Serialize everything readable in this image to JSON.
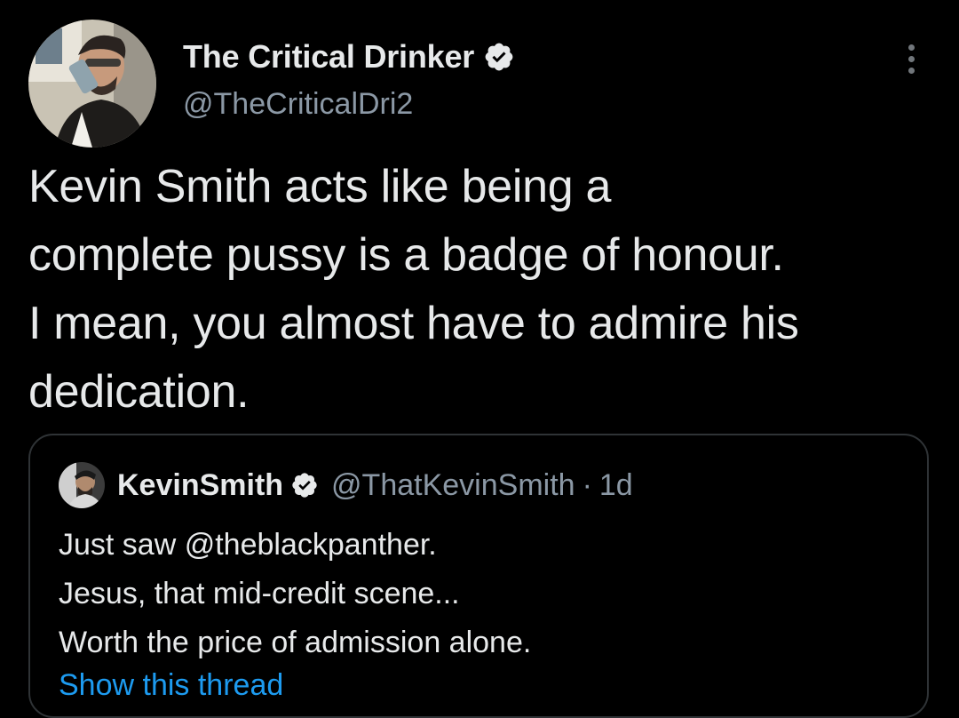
{
  "theme": {
    "background": "#000000",
    "text": "#e7e9ea",
    "secondary_text": "#8b98a5",
    "link": "#1d9bf0",
    "verified_badge": "#e7e9ea",
    "border": "#2f3336"
  },
  "tweet": {
    "author": {
      "display_name": "The Critical Drinker",
      "handle": "@TheCriticalDri2",
      "verified_icon": "verified-badge-icon",
      "avatar_icon": "profile-photo"
    },
    "more_icon": "more-vertical-icon",
    "text_lines": [
      "Kevin Smith acts like being a",
      "complete pussy is a badge of honour.",
      "I mean, you almost have to admire his",
      "dedication."
    ],
    "quote": {
      "display_name": "KevinSmith",
      "handle": "@ThatKevinSmith",
      "separator": "·",
      "time": "1d",
      "verified_icon": "verified-badge-icon",
      "body_lines": [
        "Just saw @theblackpanther.",
        "Jesus, that mid-credit scene...",
        "Worth the price of admission alone."
      ],
      "show_thread": "Show this thread"
    }
  }
}
